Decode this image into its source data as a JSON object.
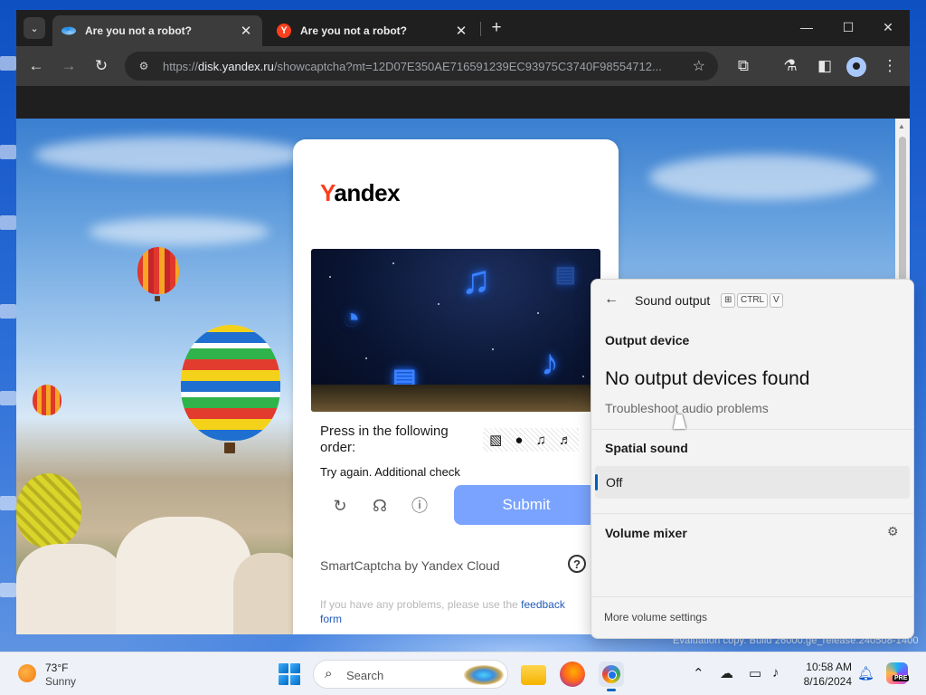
{
  "browser": {
    "tabs": [
      {
        "title": "Are you not a robot?",
        "active": true,
        "favicon": "yandex-disk-icon"
      },
      {
        "title": "Are you not a robot?",
        "active": false,
        "favicon": "yandex-icon",
        "favicon_letter": "Y"
      }
    ],
    "window_controls": {
      "minimize": "—",
      "maximize": "☐",
      "close": "✕"
    },
    "url": {
      "prefix": "https://",
      "host": "disk.yandex.ru",
      "rest": "/showcaptcha?mt=12D07E350AE716591239EC93975C3740F98554712..."
    }
  },
  "captcha": {
    "logo_first": "Y",
    "logo_rest": "andex",
    "instruction": "Press in the following order:",
    "sequence_icons": [
      "▧",
      "●",
      "♫",
      "♬"
    ],
    "status": "Try again. Additional check",
    "icons": [
      "refresh-icon",
      "headphones-icon",
      "info-icon"
    ],
    "submit_label": "Submit",
    "branding": "SmartCaptcha by Yandex Cloud",
    "help_symbol": "?",
    "footer_text": "If you have any problems, please use the ",
    "footer_link": "feedback form"
  },
  "sound_panel": {
    "title": "Sound output",
    "shortcut_keys": [
      "CTRL",
      "V"
    ],
    "output_device_heading": "Output device",
    "no_devices": "No output devices found",
    "troubleshoot_link": "Troubleshoot audio problems",
    "spatial_heading": "Spatial sound",
    "spatial_value": "Off",
    "mixer_heading": "Volume mixer",
    "more_settings": "More volume settings"
  },
  "desktop": {
    "watermark": "Evaluation copy. Build 26000.ge_release.240508-1400"
  },
  "taskbar": {
    "weather_temp": "73°F",
    "weather_condition": "Sunny",
    "search_label": "Search",
    "time": "10:58 AM",
    "date": "8/16/2024",
    "copilot_badge": "PRE"
  },
  "colors": {
    "accent": "#005fb8",
    "submit": "#7aa3ff",
    "yandex_red": "#fc3f1d"
  }
}
